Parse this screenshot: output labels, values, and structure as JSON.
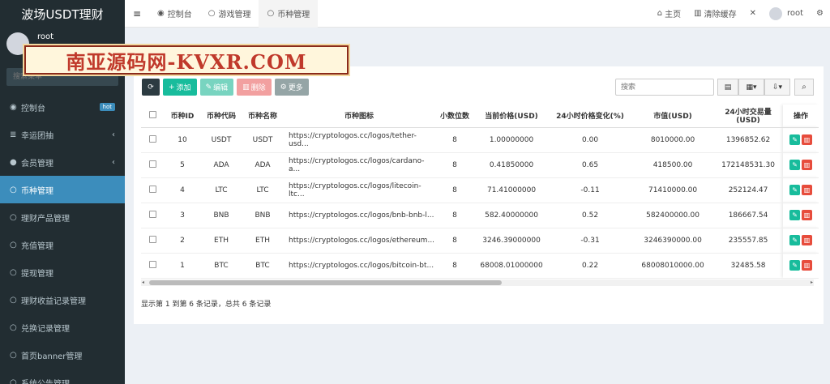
{
  "app": {
    "title": "波场USDT理财"
  },
  "user": {
    "name": "root"
  },
  "sidebar": {
    "search_placeholder": "搜索菜单",
    "items": [
      {
        "label": "控制台",
        "icon": "dashboard-icon",
        "badge": "hot"
      },
      {
        "label": "幸运团抽",
        "icon": "list-icon",
        "caret": "‹"
      },
      {
        "label": "会员管理",
        "icon": "user-icon",
        "caret": "‹"
      },
      {
        "label": "币种管理",
        "icon": "circle-icon",
        "active": true
      },
      {
        "label": "理财产品管理",
        "icon": "circle-icon"
      },
      {
        "label": "充值管理",
        "icon": "circle-icon"
      },
      {
        "label": "提现管理",
        "icon": "circle-icon"
      },
      {
        "label": "理财收益记录管理",
        "icon": "circle-icon"
      },
      {
        "label": "兑换记录管理",
        "icon": "circle-icon"
      },
      {
        "label": "首页banner管理",
        "icon": "circle-icon"
      },
      {
        "label": "系统公告管理",
        "icon": "circle-icon"
      }
    ]
  },
  "watermark": {
    "text": "南亚源码网-KVXR.COM"
  },
  "topbar": {
    "tabs": [
      {
        "label": "控制台",
        "icon": "dashboard-icon"
      },
      {
        "label": "游戏管理",
        "icon": "circle-icon"
      },
      {
        "label": "币种管理",
        "icon": "circle-icon",
        "active": true
      }
    ],
    "home_label": "主页",
    "clear_cache_label": "清除缓存",
    "user": "root"
  },
  "toolbar": {
    "add_label": "添加",
    "edit_label": "编辑",
    "delete_label": "删除",
    "more_label": "更多",
    "search_placeholder": "搜索"
  },
  "table": {
    "headers": [
      "币种ID",
      "币种代码",
      "币种名称",
      "币种图标",
      "小数位数",
      "当前价格(USD)",
      "24小时价格变化(%)",
      "市值(USD)",
      "24小时交易量(USD)",
      "操作"
    ],
    "rows": [
      {
        "id": "10",
        "code": "USDT",
        "name": "USDT",
        "icon": "https://cryptologos.cc/logos/tether-usd...",
        "decimals": "8",
        "price": "1.00000000",
        "change": "0.00",
        "mcap": "8010000.00",
        "volume": "1396852.62"
      },
      {
        "id": "5",
        "code": "ADA",
        "name": "ADA",
        "icon": "https://cryptologos.cc/logos/cardano-a...",
        "decimals": "8",
        "price": "0.41850000",
        "change": "0.65",
        "mcap": "418500.00",
        "volume": "172148531.30"
      },
      {
        "id": "4",
        "code": "LTC",
        "name": "LTC",
        "icon": "https://cryptologos.cc/logos/litecoin-ltc...",
        "decimals": "8",
        "price": "71.41000000",
        "change": "-0.11",
        "mcap": "71410000.00",
        "volume": "252124.47"
      },
      {
        "id": "3",
        "code": "BNB",
        "name": "BNB",
        "icon": "https://cryptologos.cc/logos/bnb-bnb-l...",
        "decimals": "8",
        "price": "582.40000000",
        "change": "0.52",
        "mcap": "582400000.00",
        "volume": "186667.54"
      },
      {
        "id": "2",
        "code": "ETH",
        "name": "ETH",
        "icon": "https://cryptologos.cc/logos/ethereum...",
        "decimals": "8",
        "price": "3246.39000000",
        "change": "-0.31",
        "mcap": "3246390000.00",
        "volume": "235557.85"
      },
      {
        "id": "1",
        "code": "BTC",
        "name": "BTC",
        "icon": "https://cryptologos.cc/logos/bitcoin-bt...",
        "decimals": "8",
        "price": "68008.01000000",
        "change": "0.22",
        "mcap": "68008010000.00",
        "volume": "32485.58"
      }
    ]
  },
  "footer": {
    "info": "显示第 1 到第 6 条记录，总共 6 条记录"
  }
}
